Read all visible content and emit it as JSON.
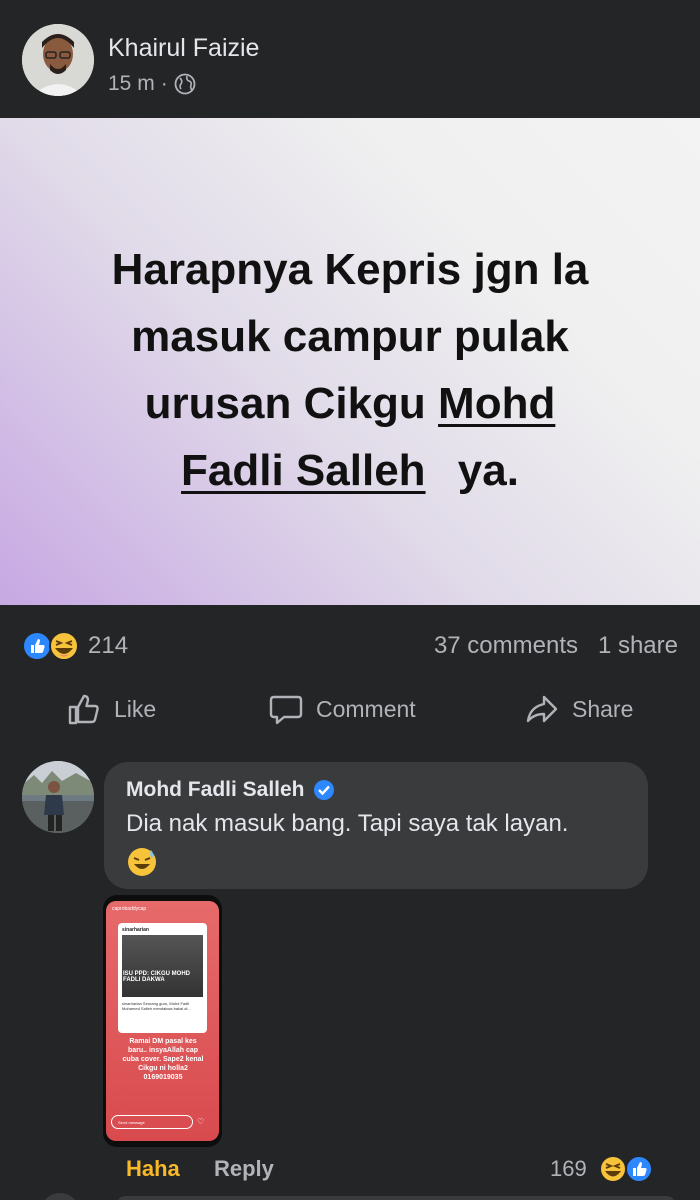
{
  "post": {
    "author": "Khairul Faizie",
    "time": "15 m",
    "separator": "·",
    "text_line1": "Harapnya Kepris jgn la",
    "text_line2": "masuk campur pulak",
    "text_line3_start": "urusan Cikgu",
    "text_link1": "Mohd",
    "text_link2": "Fadli Salleh",
    "text_line4_end": "ya.",
    "reaction_count": "214",
    "comments_count": "37 comments",
    "share_count": "1 share"
  },
  "actions": {
    "like": "Like",
    "comment": "Comment",
    "share": "Share"
  },
  "comment": {
    "name": "Mohd Fadli Salleh",
    "text": "Dia nak masuk bang. Tapi saya tak layan.",
    "reaction_label": "Haha",
    "reply_label": "Reply",
    "reaction_count": "169",
    "attachment": {
      "account": "caprobaddycap",
      "source": "sinarharian",
      "headline": "ISU PPD: CIKGU MOHD FADLI DAKWA",
      "card_caption": "sinarharian Seorang guru, Mohd Fadli Mohamed Salleh mendakwa bakal di...",
      "caption": "Ramai DM pasal kes baru.. insyaAllah cap cuba cover. Sape2 kenal Cikgu ni holla2 0169019035",
      "input_placeholder": "Send message"
    }
  },
  "colors": {
    "background": "#242526",
    "bubble": "#3a3b3c",
    "haha_accent": "#f7b928",
    "like_blue": "#2d88ff",
    "muted_text": "#b0b3b8"
  },
  "icons": [
    "globe-icon",
    "like-reaction-icon",
    "haha-reaction-icon",
    "thumbs-up-icon",
    "comment-icon",
    "share-arrow-icon",
    "verified-badge-icon",
    "sweat-smile-emoji"
  ]
}
